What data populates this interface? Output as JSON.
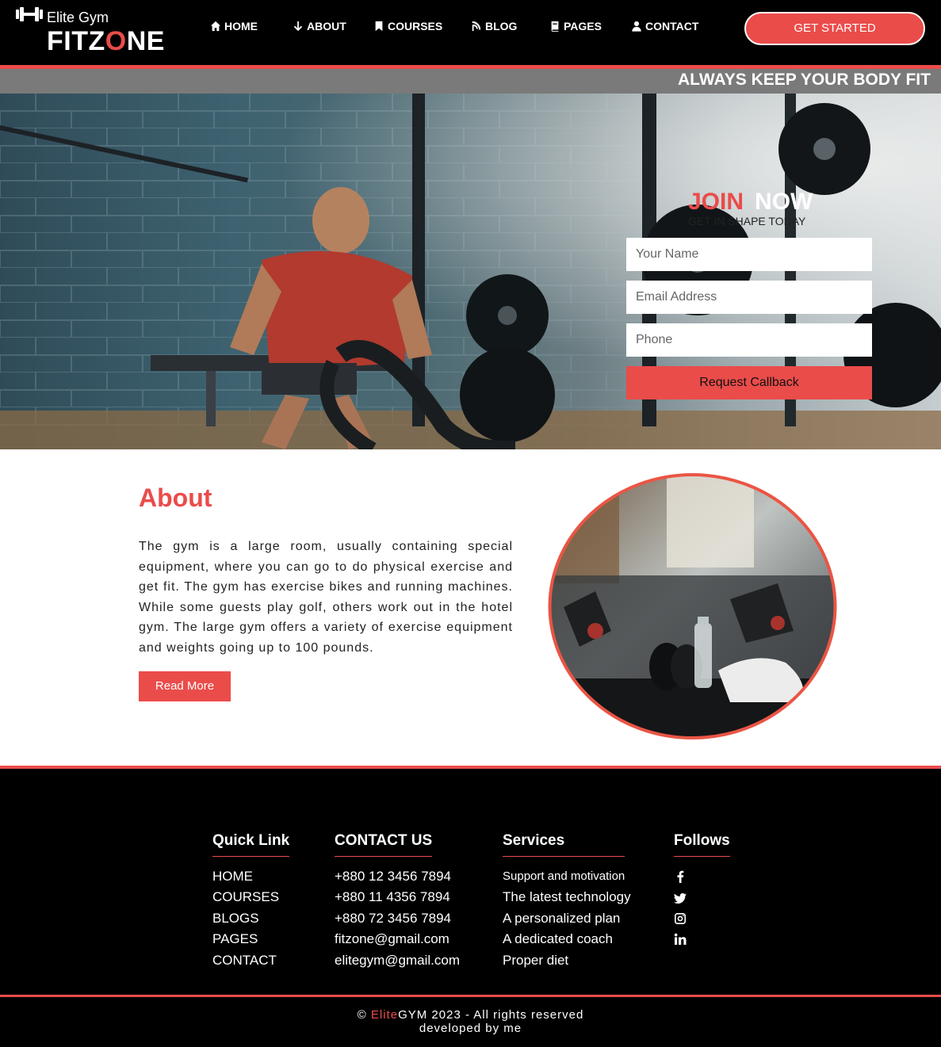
{
  "brand": {
    "small": "Elite Gym",
    "main_prefix": "FITZ",
    "main_accent": "O",
    "main_suffix": "NE"
  },
  "nav": [
    {
      "label": "HOME",
      "icon": "home-icon"
    },
    {
      "label": "ABOUT",
      "icon": "arrow-down-icon"
    },
    {
      "label": "COURSES",
      "icon": "bookmark-icon"
    },
    {
      "label": "BLOG",
      "icon": "blog-icon"
    },
    {
      "label": "PAGES",
      "icon": "book-icon"
    },
    {
      "label": "CONTACT",
      "icon": "user-icon"
    }
  ],
  "header_cta": "GET STARTED",
  "marquee": "ALWAYS KEEP YOUR BODY FIT",
  "join": {
    "title_1": "JOIN",
    "title_2": "NOW",
    "subtitle": "GET IN SHAPE TODAY",
    "name_placeholder": "Your Name",
    "email_placeholder": "Email Address",
    "phone_placeholder": "Phone",
    "submit": "Request Callback"
  },
  "about": {
    "title": "About",
    "text": "The gym is a large room, usually containing special equipment, where you can go to do physical exercise and get fit. The gym has exercise bikes and running machines. While some guests play golf, others work out in the hotel gym. The large gym offers a variety of exercise equipment and weights going up to 100 pounds.",
    "button": "Read More"
  },
  "footer": {
    "quick_link": {
      "title": "Quick Link",
      "items": [
        "HOME",
        "COURSES",
        "BLOGS",
        "PAGES",
        "CONTACT"
      ]
    },
    "contact": {
      "title": "CONTACT US",
      "items": [
        "+880 12 3456 7894",
        "+880 11 4356 7894",
        "+880 72 3456 7894",
        "fitzone@gmail.com",
        "elitegym@gmail.com"
      ]
    },
    "services": {
      "title": "Services",
      "items": [
        "Support and motivation",
        "The latest technology",
        "A personalized plan",
        "A dedicated coach",
        "Proper diet"
      ]
    },
    "follows": {
      "title": "Follows",
      "icons": [
        "facebook-icon",
        "twitter-icon",
        "instagram-icon",
        "linkedin-icon"
      ]
    }
  },
  "copyright": {
    "prefix": "© ",
    "brand_accent": "Elite",
    "brand_rest": "GYM 2023 - All rights reserved",
    "line2": "developed by me"
  },
  "colors": {
    "accent": "#ea4c4a",
    "header_bg": "#000000",
    "marquee_bg": "#7a7a7a"
  }
}
